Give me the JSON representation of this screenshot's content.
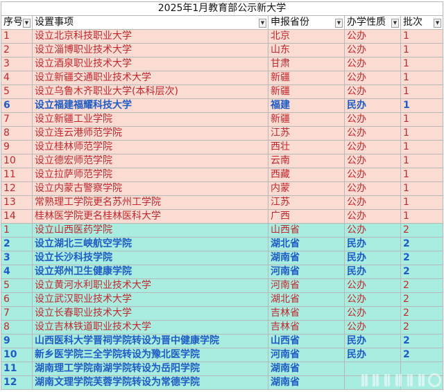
{
  "sheet": {
    "title": "2025年1月教育部公示新大学",
    "headers": [
      "序号",
      "设置事项",
      "申报省份",
      "办学性质",
      "批次"
    ]
  },
  "rows": [
    {
      "no": "1",
      "item": "设立北京科技职业大学",
      "province": "北京",
      "type": "公办",
      "batch": "1",
      "band": "b1",
      "blue": false
    },
    {
      "no": "2",
      "item": "设立淄博职业技术大学",
      "province": "山东",
      "type": "公办",
      "batch": "1",
      "band": "b1",
      "blue": false
    },
    {
      "no": "3",
      "item": "设立酒泉职业技术大学",
      "province": "甘肃",
      "type": "公办",
      "batch": "1",
      "band": "b1",
      "blue": false
    },
    {
      "no": "4",
      "item": "设立新疆交通职业技术大学",
      "province": "新疆",
      "type": "公办",
      "batch": "1",
      "band": "b1",
      "blue": false
    },
    {
      "no": "5",
      "item": "设立乌鲁木齐职业大学(本科层次)",
      "province": "新疆",
      "type": "公办",
      "batch": "1",
      "band": "b1",
      "blue": false
    },
    {
      "no": "6",
      "item": "设立福建福耀科技大学",
      "province": "福建",
      "type": "民办",
      "batch": "1",
      "band": "b1",
      "blue": true
    },
    {
      "no": "7",
      "item": "设立新疆工业学院",
      "province": "新疆",
      "type": "公办",
      "batch": "1",
      "band": "b1",
      "blue": false
    },
    {
      "no": "8",
      "item": "设立连云港师范学院",
      "province": "江苏",
      "type": "公办",
      "batch": "1",
      "band": "b1",
      "blue": false
    },
    {
      "no": "9",
      "item": "设立桂林师范学院",
      "province": "西壮",
      "type": "公办",
      "batch": "1",
      "band": "b1",
      "blue": false
    },
    {
      "no": "10",
      "item": "设立德宏师范学院",
      "province": "云南",
      "type": "公办",
      "batch": "1",
      "band": "b1",
      "blue": false
    },
    {
      "no": "11",
      "item": "设立拉萨师范学院",
      "province": "西藏",
      "type": "公办",
      "batch": "1",
      "band": "b1",
      "blue": false
    },
    {
      "no": "12",
      "item": "设立内蒙古警察学院",
      "province": "内蒙",
      "type": "公办",
      "batch": "1",
      "band": "b1",
      "blue": false
    },
    {
      "no": "13",
      "item": "常熟理工学院更名苏州工学院",
      "province": "江苏",
      "type": "公办",
      "batch": "1",
      "band": "b1",
      "blue": false
    },
    {
      "no": "14",
      "item": "桂林医学院更名桂林医科大学",
      "province": "广西",
      "type": "公办",
      "batch": "1",
      "band": "b1",
      "blue": false
    },
    {
      "no": "1",
      "item": "设立山西医药学院",
      "province": "山西省",
      "type": "公办",
      "batch": "2",
      "band": "b2",
      "blue": false
    },
    {
      "no": "2",
      "item": "设立湖北三峡航空学院",
      "province": "湖北省",
      "type": "民办",
      "batch": "2",
      "band": "b2",
      "blue": true
    },
    {
      "no": "3",
      "item": "设立长沙科技学院",
      "province": "湖南省",
      "type": "民办",
      "batch": "2",
      "band": "b2",
      "blue": true
    },
    {
      "no": "4",
      "item": "设立郑州卫生健康学院",
      "province": "河南省",
      "type": "民办",
      "batch": "2",
      "band": "b2",
      "blue": true
    },
    {
      "no": "5",
      "item": "设立黄河水利职业技术大学",
      "province": "河南省",
      "type": "公办",
      "batch": "2",
      "band": "b2",
      "blue": false
    },
    {
      "no": "6",
      "item": "设立武汉职业技术大学",
      "province": "湖北省",
      "type": "公办",
      "batch": "2",
      "band": "b2",
      "blue": false
    },
    {
      "no": "7",
      "item": "设立长春职业技术大学",
      "province": "吉林省",
      "type": "公办",
      "batch": "2",
      "band": "b2",
      "blue": false
    },
    {
      "no": "8",
      "item": "设立吉林铁道职业技术大学",
      "province": "吉林省",
      "type": "公办",
      "batch": "2",
      "band": "b2",
      "blue": false
    },
    {
      "no": "9",
      "item": "山西医科大学晋祠学院转设为晋中健康学院",
      "province": "山西省",
      "type": "民办",
      "batch": "2",
      "band": "b2",
      "blue": true
    },
    {
      "no": "10",
      "item": "新乡医学院三全学院转设为豫北医学院",
      "province": "河南省",
      "type": "民办",
      "batch": "2",
      "band": "b2",
      "blue": true
    },
    {
      "no": "11",
      "item": "湖南理工学院南湖学院转设为岳阳学院",
      "province": "湖南省",
      "type": "",
      "batch": "",
      "band": "b2",
      "blue": true
    },
    {
      "no": "12",
      "item": "湖南文理学院芙蓉学院转设为常德学院",
      "province": "湖南省",
      "type": "",
      "batch": "",
      "band": "b2",
      "blue": true
    }
  ],
  "icons": {
    "dropdown": "filter-dropdown-icon"
  },
  "colors": {
    "batch1_bg": "#fadcd2",
    "batch2_bg": "#a9ede0",
    "public_text": "#c0282d",
    "private_text": "#1f5cc6"
  }
}
